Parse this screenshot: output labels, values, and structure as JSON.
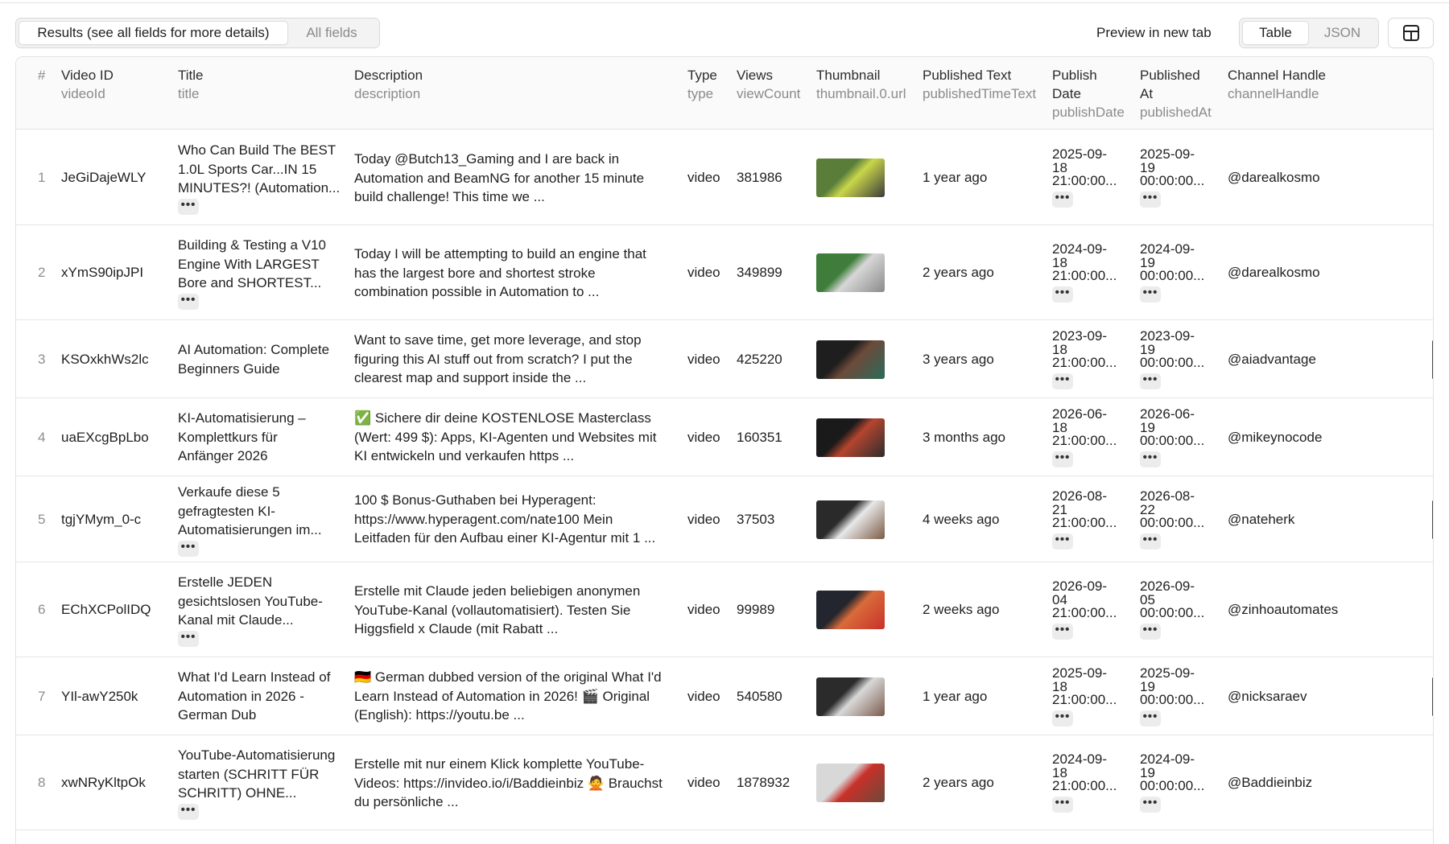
{
  "toolbar": {
    "tab_results": "Results (see all fields for more details)",
    "tab_all_fields": "All fields",
    "preview_link": "Preview in new tab",
    "view_table": "Table",
    "view_json": "JSON"
  },
  "columns": [
    {
      "label": "#",
      "sub": ""
    },
    {
      "label": "Video ID",
      "sub": "videoId"
    },
    {
      "label": "Title",
      "sub": "title"
    },
    {
      "label": "Description",
      "sub": "description"
    },
    {
      "label": "Type",
      "sub": "type"
    },
    {
      "label": "Views",
      "sub": "viewCount"
    },
    {
      "label": "Thumbnail",
      "sub": "thumbnail.0.url"
    },
    {
      "label": "Published Text",
      "sub": "publishedTimeText"
    },
    {
      "label": "Publish Date",
      "sub": "publishDate"
    },
    {
      "label": "Published At",
      "sub": "publishedAt"
    },
    {
      "label": "Channel Handle",
      "sub": "channelHandle"
    }
  ],
  "header_wrapped": {
    "publish_date_l1": "Publish",
    "publish_date_l2": "Date",
    "published_at_l1": "Published",
    "published_at_l2": "At"
  },
  "rows": [
    {
      "num": "1",
      "videoId": "JeGiDajeWLY",
      "title": [
        "Who Can Build The BEST",
        "1.0L Sports Car...IN 15",
        "MINUTES?! (Automation..."
      ],
      "desc": [
        "Today @Butch13_Gaming and I are back in",
        "Automation and BeamNG for another 15 minute",
        "build challenge! This time we ..."
      ],
      "type": "video",
      "views": "381986",
      "thumbColors": [
        "#5a7d3a",
        "#c9d64a",
        "#3a3a3a"
      ],
      "published": "1 year ago",
      "publishDate": [
        "2025-09-",
        "18",
        "21:00:00..."
      ],
      "publishedAt": [
        "2025-09-",
        "19",
        "00:00:00..."
      ],
      "handle": "@darealkosmo"
    },
    {
      "num": "2",
      "videoId": "xYmS90ipJPI",
      "title": [
        "Building & Testing a V10",
        "Engine With LARGEST",
        "Bore and SHORTEST..."
      ],
      "desc": [
        "Today I will be attempting to build an engine that",
        "has the largest bore and shortest stroke",
        "combination possible in Automation to ..."
      ],
      "type": "video",
      "views": "349899",
      "thumbColors": [
        "#3e7d3a",
        "#d7d7d7",
        "#8a8a8a"
      ],
      "published": "2 years ago",
      "publishDate": [
        "2024-09-",
        "18",
        "21:00:00..."
      ],
      "publishedAt": [
        "2024-09-",
        "19",
        "00:00:00..."
      ],
      "handle": "@darealkosmo"
    },
    {
      "num": "3",
      "videoId": "KSOxkhWs2lc",
      "title": [
        "AI Automation: Complete",
        "Beginners Guide",
        ""
      ],
      "desc": [
        "Want to save time, get more leverage, and stop",
        "figuring this AI stuff out from scratch? I put the",
        "clearest map and support inside the ..."
      ],
      "type": "video",
      "views": "425220",
      "thumbColors": [
        "#1e1e1e",
        "#6c4a3a",
        "#2a6a5a"
      ],
      "published": "3 years ago",
      "publishDate": [
        "2023-09-",
        "18",
        "21:00:00..."
      ],
      "publishedAt": [
        "2023-09-",
        "19",
        "00:00:00..."
      ],
      "handle": "@aiadvantage"
    },
    {
      "num": "4",
      "videoId": "uaEXcgBpLbo",
      "title": [
        "KI-Automatisierung –",
        "Komplettkurs für",
        "Anfänger 2026"
      ],
      "desc": [
        "✅ Sichere dir deine KOSTENLOSE Masterclass",
        "(Wert: 499 $): Apps, KI-Agenten und Websites mit",
        "KI entwickeln und verkaufen https ..."
      ],
      "type": "video",
      "views": "160351",
      "thumbColors": [
        "#1a1a1a",
        "#b5452f",
        "#2c2c2c"
      ],
      "published": "3 months ago",
      "publishDate": [
        "2026-06-",
        "18",
        "21:00:00..."
      ],
      "publishedAt": [
        "2026-06-",
        "19",
        "00:00:00..."
      ],
      "handle": "@mikeynocode"
    },
    {
      "num": "5",
      "videoId": "tgjYMym_0-c",
      "title": [
        "Verkaufe diese 5",
        "gefragtesten KI-",
        "Automatisierungen im..."
      ],
      "desc": [
        "100 $ Bonus-Guthaben bei Hyperagent:",
        "https://www.hyperagent.com/nate100 Mein",
        "Leitfaden für den Aufbau einer KI-Agentur mit 1 ..."
      ],
      "type": "video",
      "views": "37503",
      "thumbColors": [
        "#2a2a2a",
        "#e8e8e8",
        "#7a5a44"
      ],
      "published": "4 weeks ago",
      "publishDate": [
        "2026-08-",
        "21",
        "21:00:00..."
      ],
      "publishedAt": [
        "2026-08-",
        "22",
        "00:00:00..."
      ],
      "handle": "@nateherk"
    },
    {
      "num": "6",
      "videoId": "EChXCPolIDQ",
      "title": [
        "Erstelle JEDEN",
        "gesichtslosen YouTube-",
        "Kanal mit Claude..."
      ],
      "desc": [
        "Erstelle mit Claude jeden beliebigen anonymen",
        "YouTube-Kanal (vollautomatisiert). Testen Sie",
        "Higgsfield x Claude (mit Rabatt ..."
      ],
      "type": "video",
      "views": "99989",
      "thumbColors": [
        "#23262e",
        "#d96b3a",
        "#c8302a"
      ],
      "published": "2 weeks ago",
      "publishDate": [
        "2026-09-",
        "04",
        "21:00:00..."
      ],
      "publishedAt": [
        "2026-09-",
        "05",
        "00:00:00..."
      ],
      "handle": "@zinhoautomates"
    },
    {
      "num": "7",
      "videoId": "YIl-awY250k",
      "title": [
        "What I'd Learn Instead of",
        "Automation in 2026 -",
        "German Dub"
      ],
      "desc": [
        "🇩🇪 German dubbed version of the original What I'd",
        "Learn Instead of Automation in 2026! 🎬 Original",
        "(English): https://youtu.be ..."
      ],
      "type": "video",
      "views": "540580",
      "thumbColors": [
        "#2b2b2b",
        "#d9d9d9",
        "#7a5a4a"
      ],
      "published": "1 year ago",
      "publishDate": [
        "2025-09-",
        "18",
        "21:00:00..."
      ],
      "publishedAt": [
        "2025-09-",
        "19",
        "00:00:00..."
      ],
      "handle": "@nicksaraev"
    },
    {
      "num": "8",
      "videoId": "xwNRyKltpOk",
      "title": [
        "YouTube-Automatisierung",
        "starten (SCHRITT FÜR",
        "SCHRITT) OHNE..."
      ],
      "desc": [
        "Erstelle mit nur einem Klick komplette YouTube-",
        "Videos: https://invideo.io/i/Baddieinbiz 🙅 Brauchst",
        "du persönliche ..."
      ],
      "type": "video",
      "views": "1878932",
      "thumbColors": [
        "#d8d8d8",
        "#c8302a",
        "#6a4a3a"
      ],
      "published": "2 years ago",
      "publishDate": [
        "2024-09-",
        "18",
        "21:00:00..."
      ],
      "publishedAt": [
        "2024-09-",
        "19",
        "00:00:00..."
      ],
      "handle": "@Baddieinbiz"
    }
  ]
}
